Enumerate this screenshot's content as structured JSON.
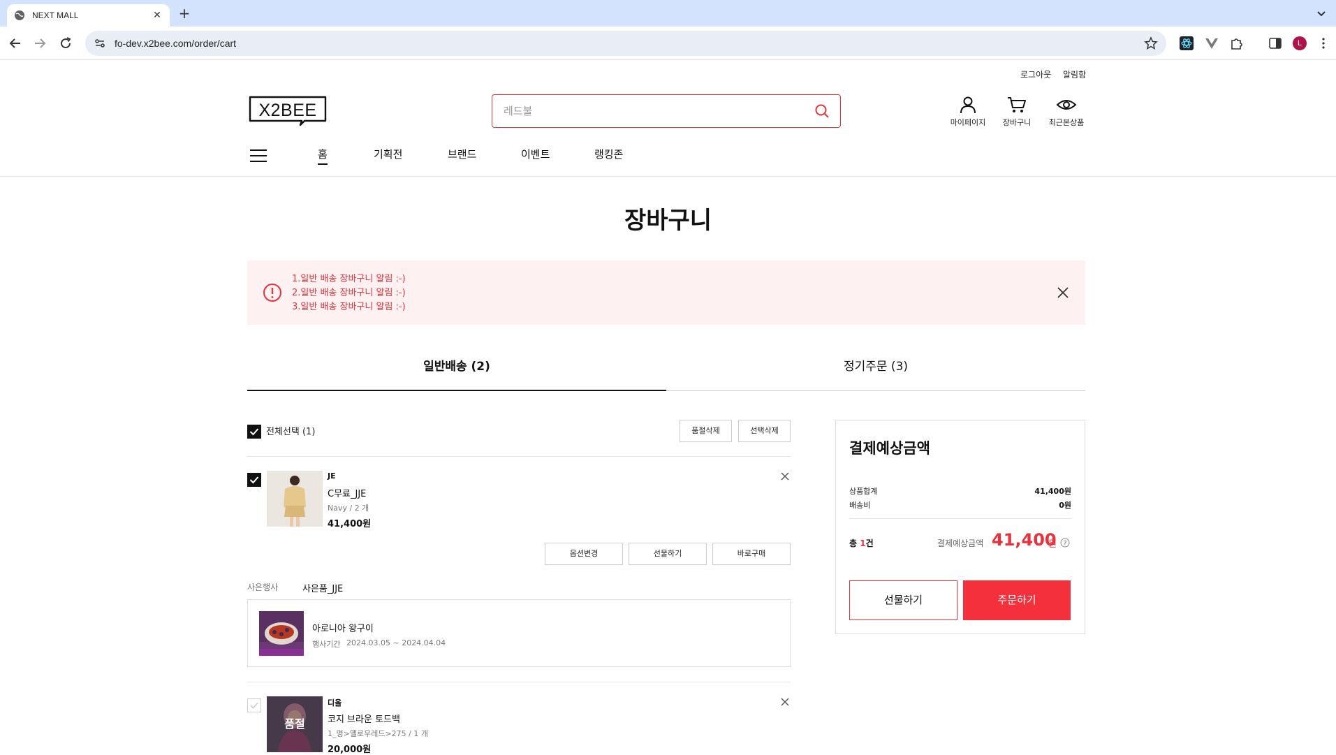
{
  "browser": {
    "tab_title": "NEXT MALL",
    "url": "fo-dev.x2bee.com/order/cart",
    "profile_initial": "L"
  },
  "header": {
    "util_links": [
      "로그아웃",
      "알림함"
    ],
    "logo_text": "X2BEE",
    "search_placeholder": "레드불",
    "icons": [
      {
        "label": "마이페이지",
        "icon": "user-icon"
      },
      {
        "label": "장바구니",
        "icon": "cart-icon"
      },
      {
        "label": "최근본상품",
        "icon": "eye-icon"
      }
    ],
    "gnb": [
      "홈",
      "기획전",
      "브랜드",
      "이벤트",
      "랭킹존"
    ]
  },
  "page": {
    "title": "장바구니",
    "notices": [
      "1.일반 배송 장바구니 알림 :-)",
      "2.일반 배송 장바구니 알림 :-)",
      "3.일반 배송 장바구니 알림 :-)"
    ],
    "tabs": [
      "일반배송 (2)",
      "정기주문 (3)"
    ]
  },
  "cart": {
    "select_all": "전체선택 (1)",
    "delete_soldout": "품절삭제",
    "delete_selected": "선택삭제",
    "items": [
      {
        "brand": "JE",
        "name": "C무료_JJE",
        "option": "Navy / 2 개",
        "price": "41,400원",
        "checked": true
      },
      {
        "brand": "디올",
        "name": "코지 브라운 토드백",
        "option": "1_명>옐로우레드>275 / 1 개",
        "price": "20,000원",
        "checked": false,
        "soldout": "품절"
      }
    ],
    "item_actions": [
      "옵션변경",
      "선물하기",
      "바로구매"
    ],
    "gift": {
      "label": "사은행사",
      "name": "사은품_JJE",
      "item_name": "아로니아 왕구이",
      "period_label": "행사기간",
      "period": "2024.03.05 ~ 2024.04.04"
    }
  },
  "summary": {
    "title": "결제예상금액",
    "rows": [
      {
        "label": "상품합계",
        "value": "41,400원"
      },
      {
        "label": "배송비",
        "value": "0원"
      }
    ],
    "count_prefix": "총 ",
    "count": "1",
    "count_suffix": "건",
    "total_label": "결제예상금액",
    "total": "41,400",
    "won": "원",
    "gift_button": "선물하기",
    "order_button": "주문하기"
  },
  "colors": {
    "accent": "#e8313b",
    "order": "#f4303d",
    "chrome": "#d3e3fd"
  }
}
